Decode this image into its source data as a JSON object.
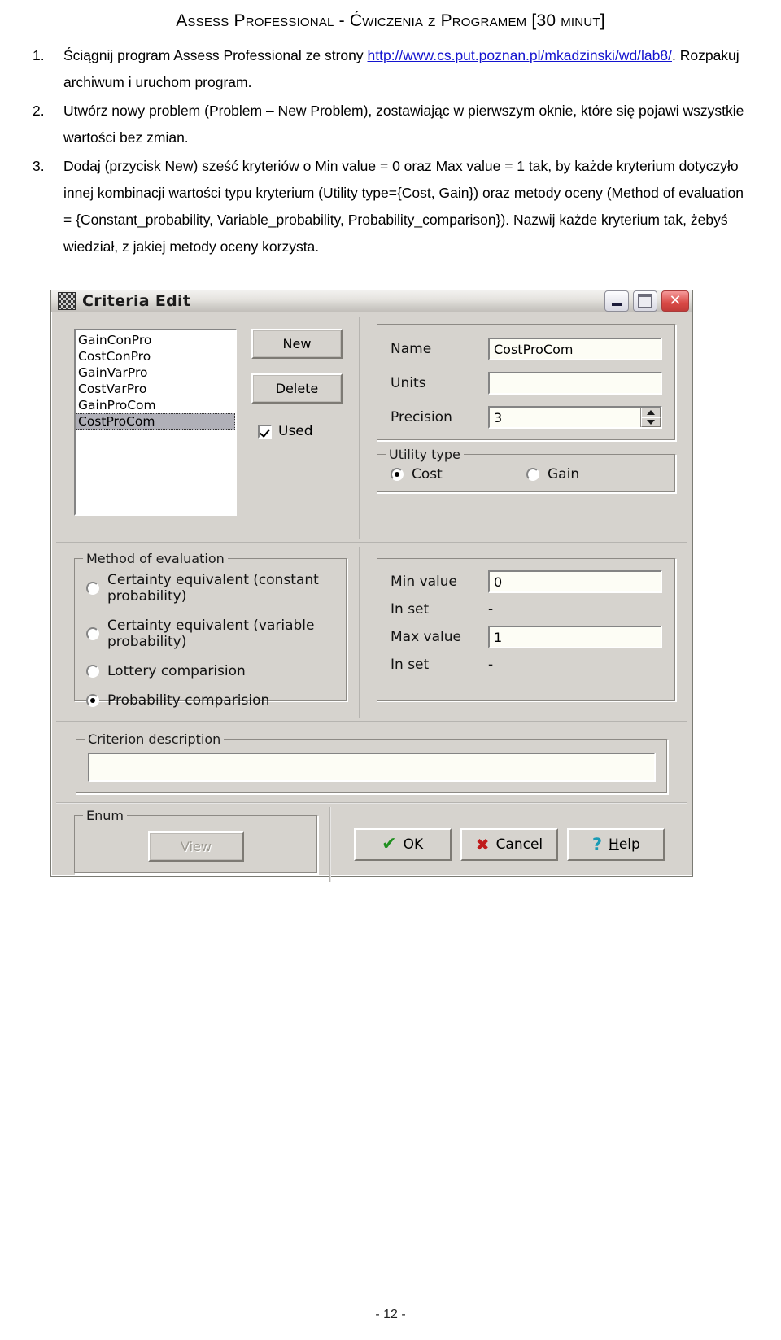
{
  "document": {
    "title": "Assess Professional - Ćwiczenia z Programem [30 minut]",
    "page_number": "- 12 -",
    "steps": [
      {
        "num": "1.",
        "parts": [
          {
            "type": "text",
            "value": "Ściągnij program Assess Professional ze strony "
          },
          {
            "type": "link",
            "value": "http://www.cs.put.poznan.pl/mkadzinski/wd/lab8/"
          },
          {
            "type": "text",
            "value": ". Rozpakuj archiwum i uruchom program."
          }
        ]
      },
      {
        "num": "2.",
        "parts": [
          {
            "type": "text",
            "value": "Utwórz nowy problem (Problem – New Problem), zostawiając w pierwszym oknie, które się pojawi wszystkie wartości bez zmian."
          }
        ]
      },
      {
        "num": "3.",
        "parts": [
          {
            "type": "text",
            "value": "Dodaj (przycisk New) sześć kryteriów o Min value = 0 oraz Max value = 1 tak, by każde kryterium dotyczyło innej kombinacji wartości typu kryterium (Utility type={Cost, Gain})  oraz metody oceny (Method of evaluation = {Constant_probability, Variable_probability, Probability_comparison}). Nazwij każde kryterium tak, żebyś wiedział, z jakiej metody oceny korzysta."
          }
        ]
      }
    ]
  },
  "dialog": {
    "title": "Criteria Edit",
    "window_buttons": {
      "minimize": "–",
      "maximize": "□",
      "close": "✕"
    },
    "criteria_list": {
      "items": [
        {
          "label": "GainConPro",
          "selected": false
        },
        {
          "label": "CostConPro",
          "selected": false
        },
        {
          "label": "GainVarPro",
          "selected": false
        },
        {
          "label": "CostVarPro",
          "selected": false
        },
        {
          "label": "GainProCom",
          "selected": false
        },
        {
          "label": "CostProCom",
          "selected": true
        }
      ]
    },
    "new_button": "New",
    "delete_button": "Delete",
    "used_checkbox": {
      "label": "Used",
      "checked": true
    },
    "properties": {
      "name_label": "Name",
      "name_value": "CostProCom",
      "units_label": "Units",
      "units_value": "",
      "precision_label": "Precision",
      "precision_value": "3"
    },
    "utility_type": {
      "legend": "Utility type",
      "options": [
        {
          "label": "Cost",
          "selected": true
        },
        {
          "label": "Gain",
          "selected": false
        }
      ]
    },
    "method_of_evaluation": {
      "legend": "Method of evaluation",
      "options": [
        {
          "label": "Certainty equivalent (constant probability)",
          "selected": false
        },
        {
          "label": "Certainty equivalent (variable probability)",
          "selected": false
        },
        {
          "label": "Lottery comparision",
          "selected": false
        },
        {
          "label": "Probability comparision",
          "selected": true
        }
      ]
    },
    "values": {
      "min_label": "Min value",
      "min_value": "0",
      "in_set_label_1": "In set",
      "in_set_value_1": "-",
      "max_label": "Max value",
      "max_value": "1",
      "in_set_label_2": "In set",
      "in_set_value_2": "-"
    },
    "criterion_description": {
      "legend": "Criterion description",
      "value": ""
    },
    "enum": {
      "legend": "Enum",
      "view_button": "View"
    },
    "buttons": {
      "ok": "OK",
      "cancel": "Cancel",
      "help_prefix": "H",
      "help_rest": "elp"
    }
  }
}
